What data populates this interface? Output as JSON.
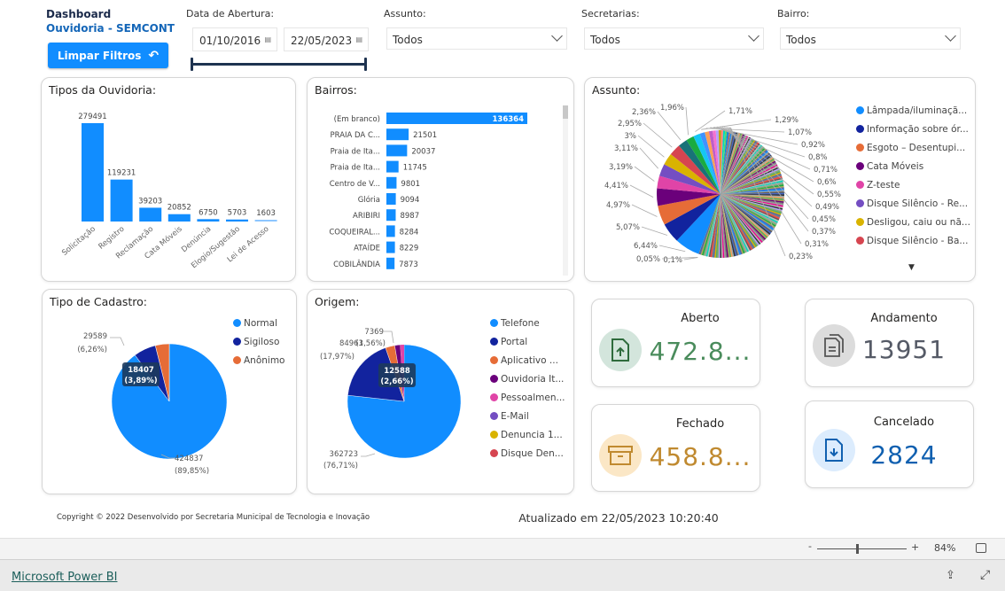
{
  "header": {
    "title_line1": "Dashboard",
    "title_line2": "Ouvidoria - SEMCONT",
    "clear_button": "Limpar Filtros",
    "clear_icon": "undo-arrow-icon"
  },
  "filters": {
    "date": {
      "label": "Data de Abertura:",
      "start": "01/10/2016",
      "end": "22/05/2023"
    },
    "assunto": {
      "label": "Assunto:",
      "value": "Todos"
    },
    "secretarias": {
      "label": "Secretarias:",
      "value": "Todos"
    },
    "bairro": {
      "label": "Bairro:",
      "value": "Todos"
    }
  },
  "palette": [
    "#118DFF",
    "#12239E",
    "#E66C37",
    "#6B007B",
    "#E044A7",
    "#744EC2",
    "#D9B300",
    "#D64550",
    "#197278",
    "#1AAB40",
    "#15C6F4",
    "#4092FF",
    "#FFA058",
    "#BE5DC9",
    "#F472D0",
    "#B5A1FF",
    "#C4A200",
    "#FF8080",
    "#00DBBC",
    "#5BD667",
    "#0091D5",
    "#4668C5",
    "#FF6300",
    "#99008A",
    "#EC008C",
    "#533285",
    "#99700A",
    "#FF4141",
    "#1F9A85",
    "#25891C"
  ],
  "chart_data": [
    {
      "type": "bar",
      "title": "Tipos da Ouvidoria:",
      "categories": [
        "Solicitação",
        "Registro",
        "Reclamação",
        "Cata Móveis",
        "Denúncia",
        "Elogio/Sugestão",
        "Lei de Acesso"
      ],
      "values": [
        279491,
        119231,
        39203,
        20852,
        6750,
        5703,
        1603
      ],
      "color": "#118DFF"
    },
    {
      "type": "bar",
      "orientation": "horizontal",
      "title": "Bairros:",
      "categories": [
        "(Em branco)",
        "PRAIA DA C...",
        "Praia de Ita...",
        "Praia de Ita...",
        "Centro de V...",
        "Glória",
        "ARIBIRI",
        "COQUEIRAL...",
        "ATAÍDE",
        "COBILÂNDIA"
      ],
      "values": [
        136364,
        21501,
        20037,
        11745,
        9801,
        9094,
        8987,
        8284,
        8229,
        7873
      ],
      "color": "#118DFF"
    },
    {
      "type": "pie",
      "title": "Assunto:",
      "legend": [
        "Lâmpada/iluminaçã...",
        "Informação sobre ór...",
        "Esgoto – Desentupi...",
        "Cata Móveis",
        "Z-teste",
        "Disque Silêncio - Re...",
        "Desligou, caiu ou nã...",
        "Disque Silêncio - Ba..."
      ],
      "slice_percent_labels": [
        "6,44%",
        "5,07%",
        "4,97%",
        "4,41%",
        "3,19%",
        "3,11%",
        "3%",
        "2,95%",
        "2,36%",
        "1,96%",
        "1,71%",
        "1,29%",
        "1,07%",
        "0,92%",
        "0,8%",
        "0,71%",
        "0,6%",
        "0,55%",
        "0,49%",
        "0,45%",
        "0,37%",
        "0,31%",
        "0,23%",
        "0,1%",
        "0,05%"
      ],
      "slice_percents": [
        6.44,
        5.07,
        4.97,
        4.41,
        3.19,
        3.11,
        3,
        2.95,
        2.36,
        1.96,
        1.71,
        1.29,
        1.07,
        0.92,
        0.8,
        0.71,
        0.6,
        0.55,
        0.49,
        0.45,
        0.37,
        0.31,
        0.23,
        0.1,
        0.05
      ]
    },
    {
      "type": "pie",
      "title": "Tipo de Cadastro:",
      "categories": [
        "Normal",
        "Sigiloso",
        "Anônimo"
      ],
      "values": [
        424837,
        29589,
        18407
      ],
      "percent_labels": [
        "(89,85%)",
        "(6,26%)",
        "(3,89%)"
      ],
      "colors": [
        "#118DFF",
        "#12239E",
        "#E66C37"
      ]
    },
    {
      "type": "pie",
      "title": "Origem:",
      "categories": [
        "Telefone",
        "Portal",
        "Aplicativo ...",
        "Ouvidoria It...",
        "Pessoalmen...",
        "E-Mail",
        "Denuncia 1...",
        "Disque Den..."
      ],
      "labelled_values": {
        "Telefone": 362723,
        "Portal": 84963,
        "Aplicativo ...": 12588,
        "Ouvidoria It...": 7369
      },
      "percent_labels": {
        "Telefone": "(76,71%)",
        "Portal": "(17,97%)",
        "Aplicativo ...": "(2,66%)",
        "Ouvidoria It...": "(1,56%)"
      },
      "percents": [
        76.71,
        17.97,
        2.66,
        1.56
      ],
      "colors": [
        "#118DFF",
        "#12239E",
        "#E66C37",
        "#6B007B",
        "#E044A7",
        "#744EC2",
        "#D9B300",
        "#D64550"
      ]
    }
  ],
  "kpis": [
    {
      "label": "Aberto",
      "value": "472.8...",
      "icon": "file-upload-icon",
      "color": "#4a8c5c",
      "bg": "#d3e5dc"
    },
    {
      "label": "Andamento",
      "value": "13951",
      "icon": "documents-icon",
      "color": "#555a66",
      "bg": "#dcdcdc"
    },
    {
      "label": "Fechado",
      "value": "458.8...",
      "icon": "archive-box-icon",
      "color": "#c08a30",
      "bg": "#fbe7c6"
    },
    {
      "label": "Cancelado",
      "value": "2824",
      "icon": "file-download-icon",
      "color": "#1060b0",
      "bg": "#dcecfd"
    }
  ],
  "footer": {
    "copyright": "Copyright © 2022 Desenvolvido por Secretaria Municipal de Tecnologia e Inovação",
    "updated": "Atualizado em 22/05/2023 10:20:40"
  },
  "viewer": {
    "zoom": "84%",
    "zoom_minus": "-",
    "zoom_plus": "+",
    "zoom_level": 0.45,
    "brand_link": "Microsoft Power BI"
  }
}
